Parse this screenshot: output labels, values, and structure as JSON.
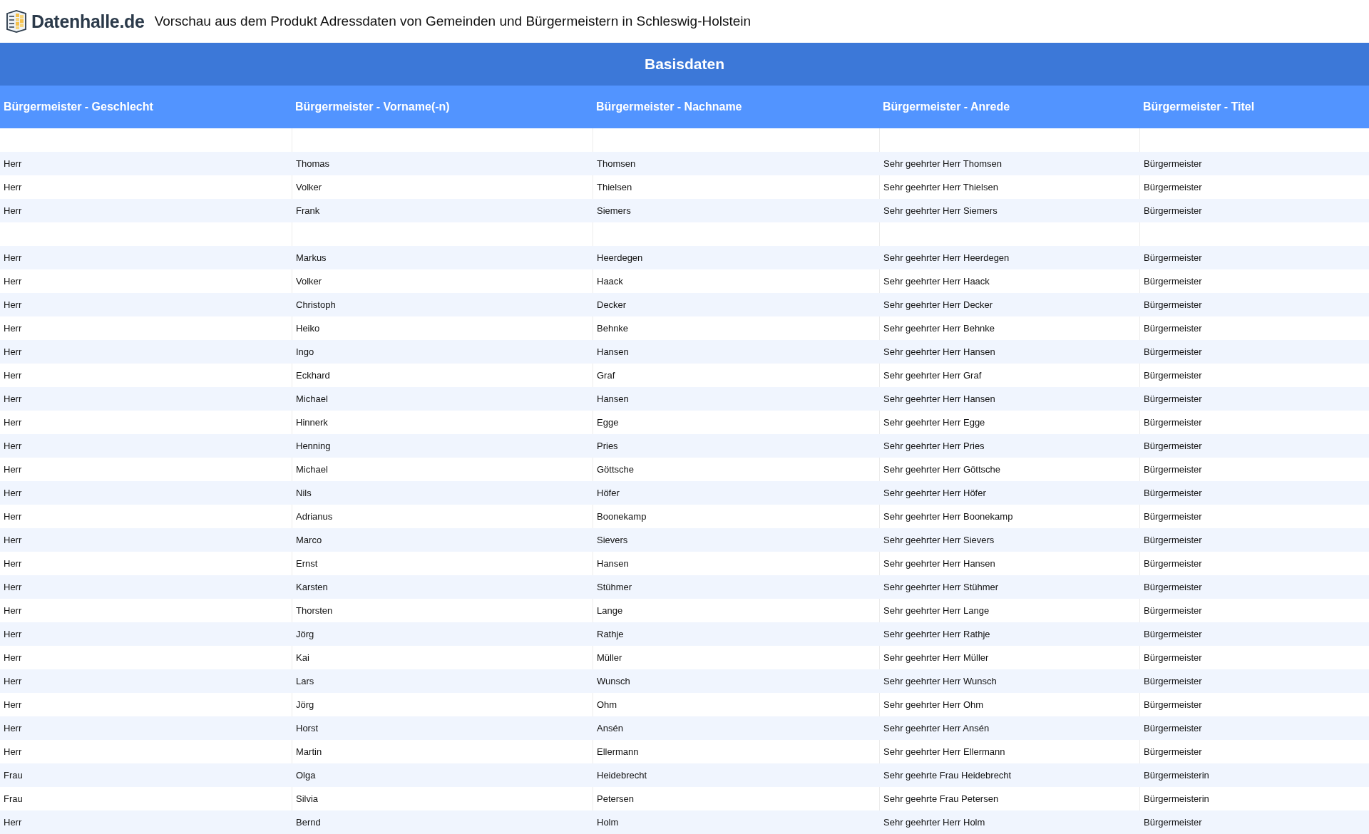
{
  "header": {
    "logo_text": "Datenhalle.de",
    "title": "Vorschau aus dem Produkt Adressdaten von Gemeinden und Bürgermeistern in Schleswig-Holstein"
  },
  "table": {
    "group_title": "Basisdaten",
    "columns": [
      "Bürgermeister - Geschlecht",
      "Bürgermeister - Vorname(-n)",
      "Bürgermeister - Nachname",
      "Bürgermeister - Anrede",
      "Bürgermeister - Titel"
    ],
    "rows": [
      {
        "kind": "blank"
      },
      {
        "kind": "data",
        "cells": [
          "Herr",
          "Thomas",
          "Thomsen",
          "Sehr geehrter Herr Thomsen",
          "Bürgermeister"
        ]
      },
      {
        "kind": "data",
        "cells": [
          "Herr",
          "Volker",
          "Thielsen",
          "Sehr geehrter Herr Thielsen",
          "Bürgermeister"
        ]
      },
      {
        "kind": "data",
        "cells": [
          "Herr",
          "Frank",
          "Siemers",
          "Sehr geehrter Herr Siemers",
          "Bürgermeister"
        ]
      },
      {
        "kind": "blank"
      },
      {
        "kind": "data",
        "cells": [
          "Herr",
          "Markus",
          "Heerdegen",
          "Sehr geehrter Herr Heerdegen",
          "Bürgermeister"
        ]
      },
      {
        "kind": "data",
        "cells": [
          "Herr",
          "Volker",
          "Haack",
          "Sehr geehrter Herr Haack",
          "Bürgermeister"
        ]
      },
      {
        "kind": "data",
        "cells": [
          "Herr",
          "Christoph",
          "Decker",
          "Sehr geehrter Herr Decker",
          "Bürgermeister"
        ]
      },
      {
        "kind": "data",
        "cells": [
          "Herr",
          "Heiko",
          "Behnke",
          "Sehr geehrter Herr Behnke",
          "Bürgermeister"
        ]
      },
      {
        "kind": "data",
        "cells": [
          "Herr",
          "Ingo",
          "Hansen",
          "Sehr geehrter Herr Hansen",
          "Bürgermeister"
        ]
      },
      {
        "kind": "data",
        "cells": [
          "Herr",
          "Eckhard",
          "Graf",
          "Sehr geehrter Herr Graf",
          "Bürgermeister"
        ]
      },
      {
        "kind": "data",
        "cells": [
          "Herr",
          "Michael",
          "Hansen",
          "Sehr geehrter Herr Hansen",
          "Bürgermeister"
        ]
      },
      {
        "kind": "data",
        "cells": [
          "Herr",
          "Hinnerk",
          "Egge",
          "Sehr geehrter Herr Egge",
          "Bürgermeister"
        ]
      },
      {
        "kind": "data",
        "cells": [
          "Herr",
          "Henning",
          "Pries",
          "Sehr geehrter Herr Pries",
          "Bürgermeister"
        ]
      },
      {
        "kind": "data",
        "cells": [
          "Herr",
          "Michael",
          "Göttsche",
          "Sehr geehrter Herr Göttsche",
          "Bürgermeister"
        ]
      },
      {
        "kind": "data",
        "cells": [
          "Herr",
          "Nils",
          "Höfer",
          "Sehr geehrter Herr Höfer",
          "Bürgermeister"
        ]
      },
      {
        "kind": "data",
        "cells": [
          "Herr",
          "Adrianus",
          "Boonekamp",
          "Sehr geehrter Herr Boonekamp",
          "Bürgermeister"
        ]
      },
      {
        "kind": "data",
        "cells": [
          "Herr",
          "Marco",
          "Sievers",
          "Sehr geehrter Herr Sievers",
          "Bürgermeister"
        ]
      },
      {
        "kind": "data",
        "cells": [
          "Herr",
          "Ernst",
          "Hansen",
          "Sehr geehrter Herr Hansen",
          "Bürgermeister"
        ]
      },
      {
        "kind": "data",
        "cells": [
          "Herr",
          "Karsten",
          "Stühmer",
          "Sehr geehrter Herr Stühmer",
          "Bürgermeister"
        ]
      },
      {
        "kind": "data",
        "cells": [
          "Herr",
          "Thorsten",
          "Lange",
          "Sehr geehrter Herr Lange",
          "Bürgermeister"
        ]
      },
      {
        "kind": "data",
        "cells": [
          "Herr",
          "Jörg",
          "Rathje",
          "Sehr geehrter Herr Rathje",
          "Bürgermeister"
        ]
      },
      {
        "kind": "data",
        "cells": [
          "Herr",
          "Kai",
          "Müller",
          "Sehr geehrter Herr Müller",
          "Bürgermeister"
        ]
      },
      {
        "kind": "data",
        "cells": [
          "Herr",
          "Lars",
          "Wunsch",
          "Sehr geehrter Herr Wunsch",
          "Bürgermeister"
        ]
      },
      {
        "kind": "data",
        "cells": [
          "Herr",
          "Jörg",
          "Ohm",
          "Sehr geehrter Herr Ohm",
          "Bürgermeister"
        ]
      },
      {
        "kind": "data",
        "cells": [
          "Herr",
          "Horst",
          "Ansén",
          "Sehr geehrter Herr Ansén",
          "Bürgermeister"
        ]
      },
      {
        "kind": "data",
        "cells": [
          "Herr",
          "Martin",
          "Ellermann",
          "Sehr geehrter Herr Ellermann",
          "Bürgermeister"
        ]
      },
      {
        "kind": "data",
        "cells": [
          "Frau",
          "Olga",
          "Heidebrecht",
          "Sehr geehrte Frau Heidebrecht",
          "Bürgermeisterin"
        ]
      },
      {
        "kind": "data",
        "cells": [
          "Frau",
          "Silvia",
          "Petersen",
          "Sehr geehrte Frau Petersen",
          "Bürgermeisterin"
        ]
      },
      {
        "kind": "data",
        "cells": [
          "Herr",
          "Bernd",
          "Holm",
          "Sehr geehrter Herr Holm",
          "Bürgermeister"
        ]
      }
    ]
  }
}
